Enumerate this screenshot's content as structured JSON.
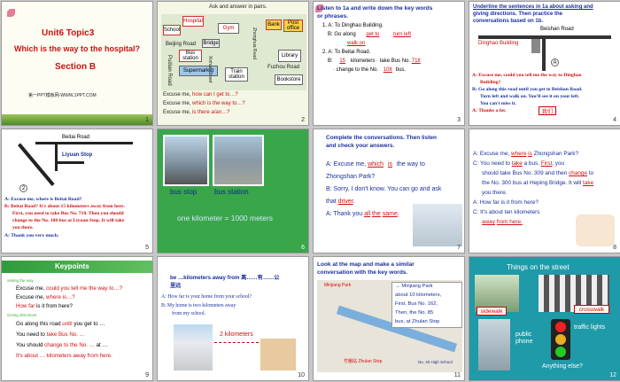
{
  "slides": [
    {
      "num": "1",
      "title": "Unit6 Topic3",
      "question": "Which is the way to the hospital?",
      "section": "Section B",
      "watermark": "第一PPT模板网-WWW.1PPT.COM"
    },
    {
      "num": "2",
      "header": "Ask and answer in pairs.",
      "places": [
        "School",
        "Hospital",
        "Gym",
        "Bank",
        "Post office",
        "Bridge",
        "Beijing Road",
        "Bus station",
        "Pudian Road",
        "Library",
        "Supermarket",
        "Train station",
        "Fuzhou Road",
        "Bookstore",
        "Xinhua Street",
        "Zhonghua Road"
      ],
      "lines": [
        {
          "a": "Excuse me, ",
          "b": "how can I get to…?"
        },
        {
          "a": "Excuse me, ",
          "b": "which is the way to…?"
        },
        {
          "a": "Excuse me, ",
          "b": "is there a/an…?"
        }
      ]
    },
    {
      "num": "3",
      "l1": "Listen to 1a and write down the key words",
      "l2": "or phrases.",
      "l3": "1. A: To Dinghao Building.",
      "l4a": "B: Go along",
      "b1": "get to",
      "b2": "turn left",
      "b3": "walk on",
      "l5": "2. A: To Beitai Road.",
      "l6a": "B:",
      "b4": "15",
      "l6b": "kilometers",
      "l6c": "· take Bus No.",
      "b5": "718",
      "l7a": "· change to the No.",
      "b6": "108",
      "l7b": "bus."
    },
    {
      "num": "4",
      "l1": "Underline the sentences in 1a about asking and",
      "l2": "giving  directions. Then practice the",
      "l3": "conversations based on 1b.",
      "road": "Beishan Road",
      "bld": "Dinghao Building",
      "a1": "A: Excuse me, could you tell me the way to Dinghao",
      "a2": "Building?",
      "b1": "B: Go along this road until you get to Beishan Road.",
      "b2": "Turn left and walk on. You'll see it on your left.",
      "b3": "You can't miss it.",
      "c1": "A: Thanks a lot.",
      "tag": "我们"
    },
    {
      "num": "5",
      "road": "Beitai Road",
      "stop": "Liyuan Stop",
      "l1": "A: Excuse me, where is Beitai Road?",
      "l2": "B: Beitai Road? It's about 15 kilometers away from here.",
      "l3": "First, you need to take Bus No. 718. Then you should",
      "l4": "change to the No. 108 bus at Liyuan Stop. It will take",
      "l5": "you there.",
      "l6": "A: Thank you very much."
    },
    {
      "num": "6",
      "c1": "bus stop",
      "c2": "bus station",
      "c3": "one kilometer = 1000 meters"
    },
    {
      "num": "7",
      "l1": "Complete the conversations.  Then listen",
      "l2": "and check your answers.",
      "l3a": "A: Excuse me,",
      "b1": "which",
      "b2": "is",
      "l3b": "the way to",
      "l4": "Zhongshan Park?",
      "l5": "B: Sorry, I don't know. You can go and ask",
      "l6a": "that",
      "b3": "driver",
      "l7a": "A: Thank you",
      "b4": "all",
      "b5": "the",
      "b6": "same"
    },
    {
      "num": "8",
      "l1a": "A:  Excuse me,",
      "b1": "where",
      "b2": "is",
      "l1b": "Zhongshan Park?",
      "l2a": "C:  You need to",
      "b3": "take",
      "l2b": "a bus.",
      "b4": "First",
      "l2c": ", you",
      "l3": "should take Bus No. 309 and then",
      "b5": "change",
      "l3b": "to",
      "l4": "the No. 300 bus at Heping Bridge.  It will",
      "b6": "take",
      "l5": "you there.",
      "l6": "A:  How far is it from here?",
      "l7a": "C:  It'",
      "l7b": "s about ten kilometers",
      "b7": "away",
      "b8": "from here."
    },
    {
      "num": "9",
      "header": "Keypoints",
      "s1": "asking the way",
      "e1a": "Excuse me, ",
      "e1b": "could you tell me the way to…?",
      "e2a": "Excuse me, ",
      "e2b": "where is…?",
      "e3a": "How far ",
      "e3b": "is it from here?",
      "s2": "Giving directions",
      "e4a": "Go along this road ",
      "e4b": "until",
      "e4c": " you get to …",
      "e5a": "You need to ",
      "e5b": "take Bus No. …",
      "e6a": "You should ",
      "e6b": "change to the No. …",
      "e6c": " at …",
      "e7": "It's about … kilometers away from here."
    },
    {
      "num": "10",
      "h1": "be …kilometers away  from   离……有……公",
      "h2": "里远",
      "q": "A:  How far is your home from your school?",
      "a1": "B:  My home is two kilometers away",
      "a2": "from my school.",
      "dist": "2 kilometers"
    },
    {
      "num": "11",
      "l1": "Look at the map and make a similar",
      "l2": "conversation with the key words.",
      "park": "Minjiang Park",
      "p1": "→ Minjiang Park",
      "p2": "about 10 kilometers,",
      "p3": "First, Bus No. 162,",
      "p4": "Then, the No. 85",
      "p5": "bus, at Zhulan Stop",
      "m1": "竹棚站 Zhulan Stop",
      "m2": "No. 40 High School"
    },
    {
      "num": "12",
      "title": "Things on the street",
      "l1": "sidewalk",
      "l2": "crosswalk",
      "l3": "public phone",
      "l4": "traffic lights",
      "l5": "Anything else?"
    }
  ],
  "colors": {
    "blue": "#1a2f9c",
    "red": "#d01010",
    "green": "#3cb043",
    "teal": "#1e9aa8"
  }
}
